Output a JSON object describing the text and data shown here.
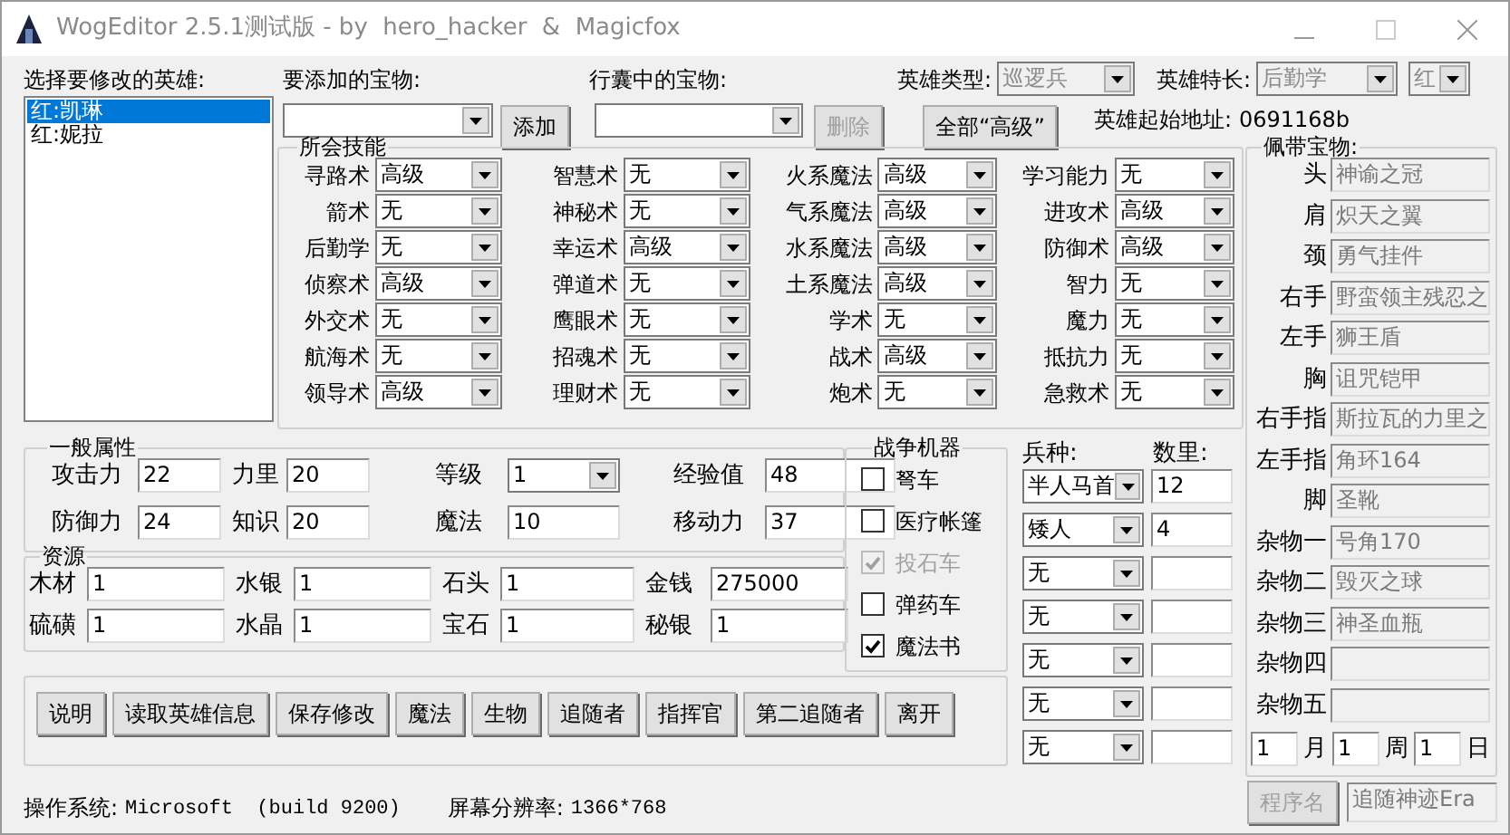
{
  "window": {
    "title": "WogEditor 2.5.1测试版 - by  hero_hacker  &  Magicfox"
  },
  "hero_list": {
    "label": "选择要修改的英雄:",
    "items": [
      {
        "text": "红:凯琳",
        "selected": true
      },
      {
        "text": "红:妮拉",
        "selected": false
      }
    ]
  },
  "artifact_add": {
    "label": "要添加的宝物:",
    "button": "添加"
  },
  "backpack": {
    "label": "行囊中的宝物:",
    "button": "删除",
    "disabled": true
  },
  "all_expert_button": "全部“高级”",
  "hero_type": {
    "label": "英雄类型:",
    "value": "巡逻兵",
    "disabled": true
  },
  "specialty": {
    "label": "英雄特长:",
    "value": "后勤学",
    "disabled": true
  },
  "color_select": {
    "value": "红",
    "disabled": true
  },
  "start_address": {
    "label": "英雄起始地址:",
    "value": "0691168b"
  },
  "skills": {
    "title": "所会技能",
    "items": [
      {
        "name": "寻路术",
        "value": "高级"
      },
      {
        "name": "智慧术",
        "value": "无"
      },
      {
        "name": "火系魔法",
        "value": "高级"
      },
      {
        "name": "学习能力",
        "value": "无"
      },
      {
        "name": "箭术",
        "value": "无"
      },
      {
        "name": "神秘术",
        "value": "无"
      },
      {
        "name": "气系魔法",
        "value": "高级"
      },
      {
        "name": "进攻术",
        "value": "高级"
      },
      {
        "name": "后勤学",
        "value": "无"
      },
      {
        "name": "幸运术",
        "value": "高级"
      },
      {
        "name": "水系魔法",
        "value": "高级"
      },
      {
        "name": "防御术",
        "value": "高级"
      },
      {
        "name": "侦察术",
        "value": "高级"
      },
      {
        "name": "弹道术",
        "value": "无"
      },
      {
        "name": "土系魔法",
        "value": "高级"
      },
      {
        "name": "智力",
        "value": "无"
      },
      {
        "name": "外交术",
        "value": "无"
      },
      {
        "name": "鹰眼术",
        "value": "无"
      },
      {
        "name": "学术",
        "value": "无"
      },
      {
        "name": "魔力",
        "value": "无"
      },
      {
        "name": "航海术",
        "value": "无"
      },
      {
        "name": "招魂术",
        "value": "无"
      },
      {
        "name": "战术",
        "value": "高级"
      },
      {
        "name": "抵抗力",
        "value": "无"
      },
      {
        "name": "领导术",
        "value": "高级"
      },
      {
        "name": "理财术",
        "value": "无"
      },
      {
        "name": "炮术",
        "value": "无"
      },
      {
        "name": "急救术",
        "value": "无"
      }
    ]
  },
  "general": {
    "title": "一般属性",
    "fields": [
      {
        "label": "攻击力",
        "value": "22",
        "kind": "text"
      },
      {
        "label": "力里",
        "value": "20",
        "kind": "text"
      },
      {
        "label": "等级",
        "value": "1",
        "kind": "select"
      },
      {
        "label": "经验值",
        "value": "48",
        "kind": "text"
      },
      {
        "label": "防御力",
        "value": "24",
        "kind": "text"
      },
      {
        "label": "知识",
        "value": "20",
        "kind": "text"
      },
      {
        "label": "魔法",
        "value": "10",
        "kind": "text"
      },
      {
        "label": "移动力",
        "value": "37",
        "kind": "text"
      }
    ]
  },
  "resources": {
    "title": "资源",
    "fields": [
      {
        "label": "木材",
        "value": "1"
      },
      {
        "label": "水银",
        "value": "1"
      },
      {
        "label": "石头",
        "value": "1"
      },
      {
        "label": "金钱",
        "value": "275000"
      },
      {
        "label": "硫磺",
        "value": "1"
      },
      {
        "label": "水晶",
        "value": "1"
      },
      {
        "label": "宝石",
        "value": "1"
      },
      {
        "label": "秘银",
        "value": "1"
      }
    ]
  },
  "war_machines": {
    "title": "战争机器",
    "items": [
      {
        "label": "弩车",
        "checked": false,
        "disabled": false
      },
      {
        "label": "医疗帐篷",
        "checked": false,
        "disabled": false
      },
      {
        "label": "投石车",
        "checked": true,
        "disabled": true
      },
      {
        "label": "弹药车",
        "checked": false,
        "disabled": false
      },
      {
        "label": "魔法书",
        "checked": true,
        "disabled": false
      }
    ]
  },
  "troops": {
    "type_label": "兵种:",
    "count_label": "数里:",
    "slots": [
      {
        "type": "半人马首",
        "count": "12"
      },
      {
        "type": "矮人",
        "count": "4"
      },
      {
        "type": "无"
      },
      {
        "type": "无"
      },
      {
        "type": "无"
      },
      {
        "type": "无"
      },
      {
        "type": "无"
      }
    ]
  },
  "buttons": [
    "说明",
    "读取英雄信息",
    "保存修改",
    "魔法",
    "生物",
    "追随者",
    "指挥官",
    "第二追随者",
    "离开"
  ],
  "equipped": {
    "title": "佩带宝物:",
    "slots": [
      {
        "label": "头",
        "value": "神谕之冠"
      },
      {
        "label": "肩",
        "value": "炽天之翼"
      },
      {
        "label": "颈",
        "value": "勇气挂件"
      },
      {
        "label": "右手",
        "value": "野蛮领主残忍之"
      },
      {
        "label": "左手",
        "value": "狮王盾"
      },
      {
        "label": "胸",
        "value": "诅咒铠甲"
      },
      {
        "label": "右手指",
        "value": "斯拉瓦的力里之"
      },
      {
        "label": "左手指",
        "value": "角环164"
      },
      {
        "label": "脚",
        "value": "圣靴"
      },
      {
        "label": "杂物一",
        "value": "号角170"
      },
      {
        "label": "杂物二",
        "value": "毁灭之球"
      },
      {
        "label": "杂物三",
        "value": "神圣血瓶"
      },
      {
        "label": "杂物四"
      },
      {
        "label": "杂物五"
      }
    ]
  },
  "date": [
    {
      "value": "1",
      "unit": "月"
    },
    {
      "value": "1",
      "unit": "周"
    },
    {
      "value": "1",
      "unit": "日"
    }
  ],
  "program": {
    "button": "程序名",
    "disabled": true,
    "value": "追随神迹Era"
  },
  "status_bar": {
    "os_label": "操作系统:",
    "os": "Microsoft  (build 9200)",
    "resolution_label": "屏幕分辨率:",
    "resolution": "1366*768"
  }
}
